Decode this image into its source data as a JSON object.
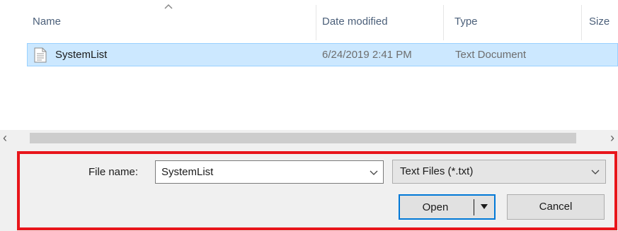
{
  "columns": {
    "name": "Name",
    "date_modified": "Date modified",
    "type": "Type",
    "size": "Size"
  },
  "files": [
    {
      "name": "SystemList",
      "date_modified": "6/24/2019 2:41 PM",
      "type": "Text Document",
      "icon": "text-file-icon",
      "selected": true
    }
  ],
  "footer": {
    "file_name_label": "File name:",
    "file_name_value": "SystemList",
    "file_type_value": "Text Files (*.txt)",
    "open_label": "Open",
    "cancel_label": "Cancel"
  },
  "colors": {
    "selection_bg": "#cce8ff",
    "selection_border": "#99d1ff",
    "highlight_border": "#e8151b",
    "default_button_border": "#0078d7"
  }
}
